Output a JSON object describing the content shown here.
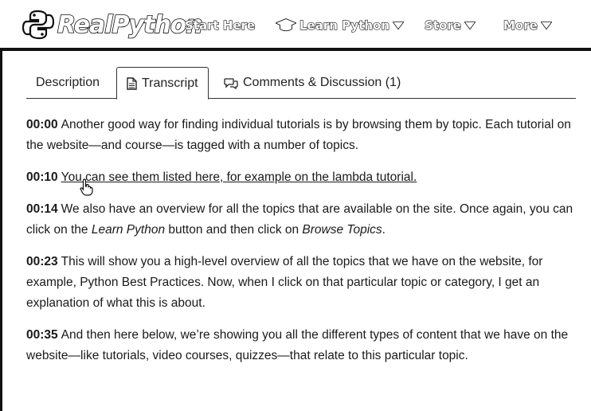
{
  "brand": {
    "logo_text": "RealPython"
  },
  "nav": {
    "start_here": "Start Here",
    "learn_python": "Learn Python",
    "store": "Store",
    "more": "More"
  },
  "tabs": [
    {
      "label": "Description"
    },
    {
      "label": "Transcript"
    },
    {
      "label": "Comments & Discussion (1)"
    }
  ],
  "transcript": [
    {
      "time": "00:00",
      "text": "Another good way for finding individual tutorials is by browsing them by topic. Each tutorial on the website—and course—is tagged with a number of topics."
    },
    {
      "time": "00:10",
      "link_text": "You can see them listed here, for example on the lambda tutorial."
    },
    {
      "time": "00:14",
      "text_a": "We also have an overview for all the topics that are available on the site. Once again, you can click on the ",
      "em_a": "Learn Python",
      "text_b": " button and then click on ",
      "em_b": "Browse Topics",
      "text_c": "."
    },
    {
      "time": "00:23",
      "text": "This will show you a high-level overview of all the topics that we have on the website, for example, Python Best Practices. Now, when I click on that particular topic or category, I get an explanation of what this is about."
    },
    {
      "time": "00:35",
      "text": "And then here below, we’re showing you all the different types of content that we have on the website—like tutorials, video courses, quizzes—that relate to this particular topic."
    }
  ],
  "colors": {
    "ink": "#111111",
    "background": "#ffffff"
  },
  "icons": [
    "python-logo-icon",
    "graduation-cap-icon",
    "caret-down-icon",
    "document-icon",
    "comments-icon",
    "hand-pointer-icon"
  ]
}
